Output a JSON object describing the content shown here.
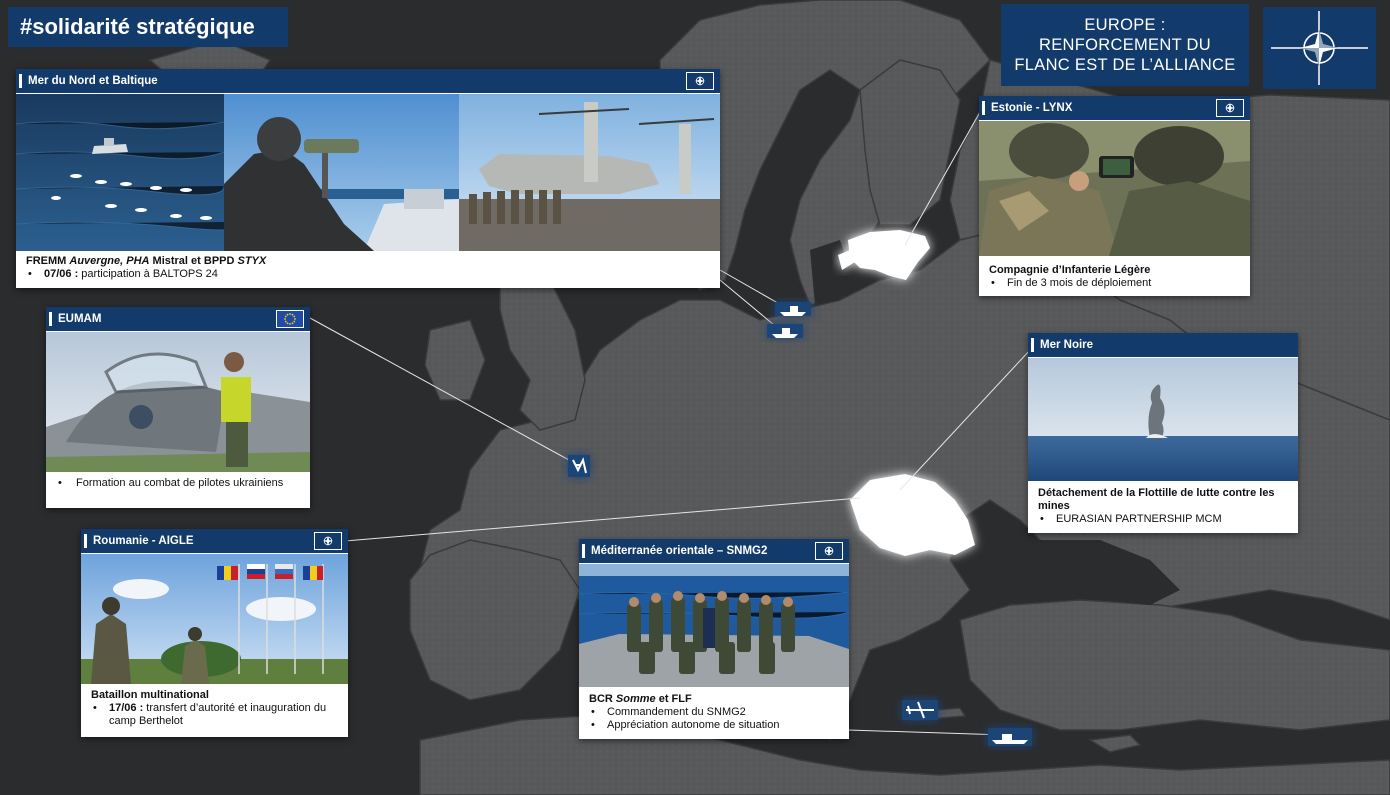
{
  "hashtag": "#solidarité stratégique",
  "headline": {
    "line1": "EUROPE :",
    "line2": "RENFORCEMENT DU",
    "line3": "FLANC EST DE L’ALLIANCE"
  },
  "logo_icon": "nato-compass-star-icon",
  "colors": {
    "navy": "#123a6a",
    "map_bg": "#2b2c2e",
    "land": "#58595b",
    "highlight": "#ffffff",
    "eu_blue": "#1f4aa8",
    "eu_star": "#f5d400"
  },
  "cards": {
    "baltic": {
      "title": "Mer du Nord et Baltique",
      "badge_icon": "nato-compass-star-icon",
      "caption_title_1": "FREMM ",
      "caption_title_2": "Auvergne, PHA",
      "caption_title_3": " Mistral et  BPPD ",
      "caption_title_4": "STYX",
      "bullet_date": "07/06 :",
      "bullet_text": " participation à BALTOPS 24"
    },
    "estonia": {
      "title": "Estonie - LYNX",
      "badge_icon": "nato-compass-star-icon",
      "caption_title": "Compagnie d’Infanterie Légère",
      "bullet": "Fin de 3 mois de déploiement"
    },
    "eumam": {
      "title": "EUMAM",
      "badge_icon": "eu-flag-icon",
      "bullet": "Formation au combat de pilotes ukrainiens"
    },
    "black_sea": {
      "title": "Mer Noire",
      "caption_title": "Détachement de la Flottille de lutte contre les mines",
      "bullet": "EURASIAN PARTNERSHIP MCM"
    },
    "romania": {
      "title": "Roumanie - AIGLE",
      "badge_icon": "nato-compass-star-icon",
      "caption_title": "Bataillon multinational",
      "bullet_date": "17/06 :",
      "bullet_text": " transfert d’autorité et inauguration du camp Berthelot"
    },
    "med": {
      "title": "Méditerranée orientale – SNMG2",
      "badge_icon": "nato-compass-star-icon",
      "caption_title_1": "BCR ",
      "caption_title_2": "Somme",
      "caption_title_3": " et FLF",
      "bullet_1": "Commandement du SNMG2",
      "bullet_2": "Appréciation autonome de situation"
    }
  },
  "map_markers": [
    "ship-icon",
    "ship-icon",
    "training-soldiers-icon",
    "aircraft-icon",
    "ship-icon"
  ]
}
